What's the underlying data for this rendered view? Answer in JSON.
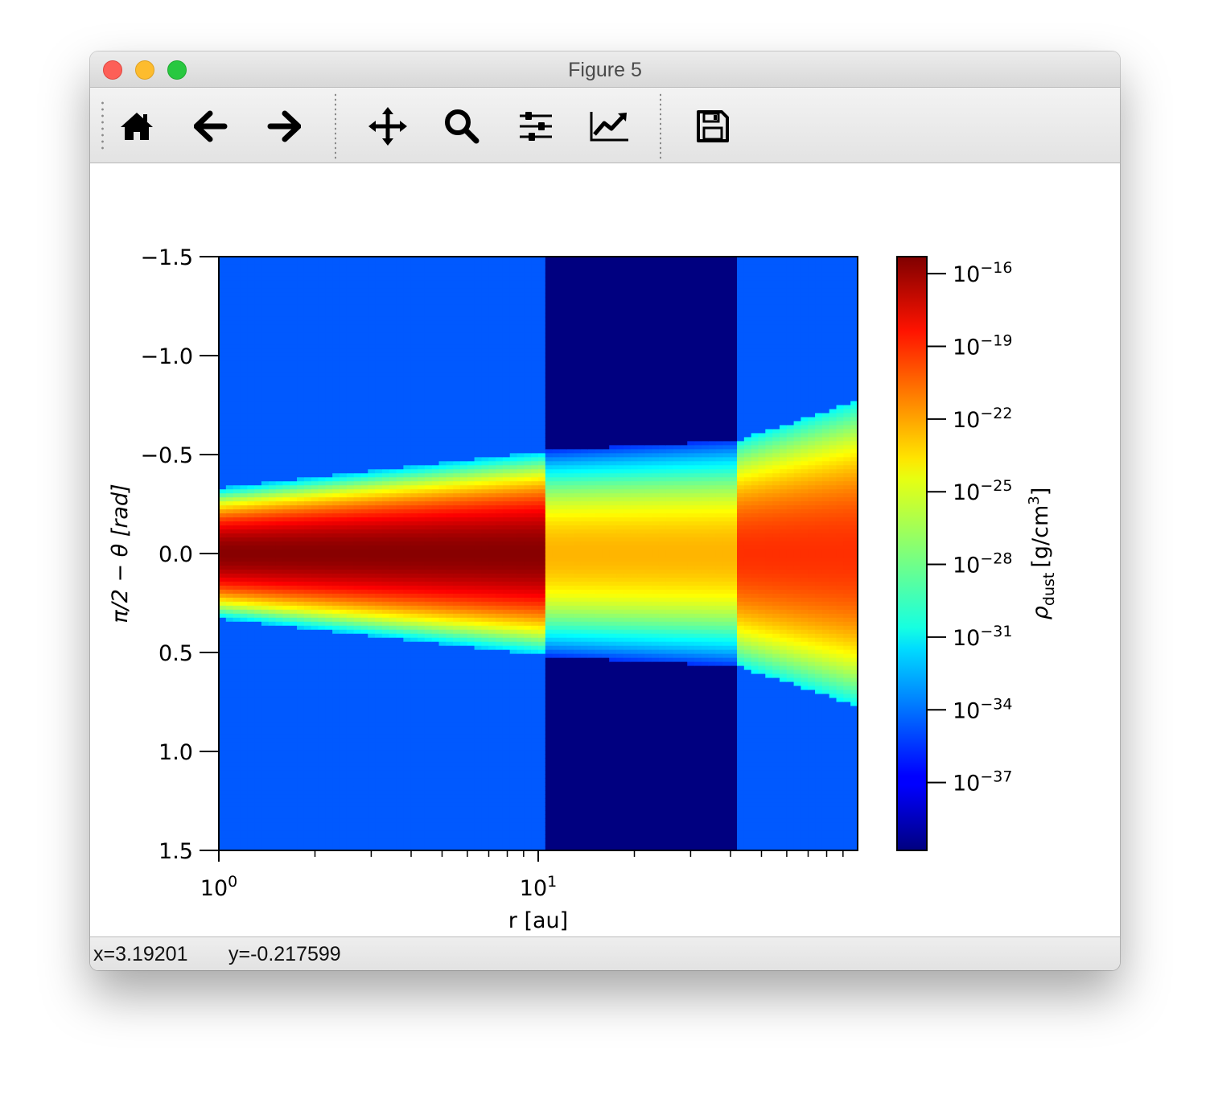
{
  "window": {
    "title": "Figure 5"
  },
  "toolbar": {
    "buttons": [
      {
        "name": "home-icon",
        "label": "Home"
      },
      {
        "name": "back-icon",
        "label": "Back"
      },
      {
        "name": "forward-icon",
        "label": "Forward"
      },
      {
        "name": "pan-icon",
        "label": "Pan"
      },
      {
        "name": "zoom-icon",
        "label": "Zoom"
      },
      {
        "name": "subplots-icon",
        "label": "Subplots"
      },
      {
        "name": "customize-icon",
        "label": "Customize"
      },
      {
        "name": "save-icon",
        "label": "Save"
      }
    ]
  },
  "status": {
    "x": "x=3.19201",
    "y": "y=-0.217599"
  },
  "chart_data": {
    "type": "heatmap",
    "colormap": "jet",
    "xlabel": "r [au]",
    "ylabel": "π/2 − θ [rad]",
    "xscale": "log",
    "x_range_au": [
      1,
      100
    ],
    "x_ticks": [
      {
        "value": 1,
        "base": "10",
        "exp": "0"
      },
      {
        "value": 10,
        "base": "10",
        "exp": "1"
      }
    ],
    "y_range": [
      -1.5,
      1.5
    ],
    "y_inverted": true,
    "y_ticks": [
      "−1.5",
      "−1.0",
      "−0.5",
      "0.0",
      "0.5",
      "1.0",
      "1.5"
    ],
    "y_tick_values": [
      -1.5,
      -1.0,
      -0.5,
      0.0,
      0.5,
      1.0,
      1.5
    ],
    "colorbar": {
      "label_symbol": "ρ",
      "label_sub": "dust",
      "label_units": "[g/cm",
      "label_sup": "3",
      "label_close": "]",
      "log_range": [
        -39.8,
        -15.3
      ],
      "ticks": [
        {
          "base": "10",
          "exp": "−16",
          "log": -16
        },
        {
          "base": "10",
          "exp": "−19",
          "log": -19
        },
        {
          "base": "10",
          "exp": "−22",
          "log": -22
        },
        {
          "base": "10",
          "exp": "−25",
          "log": -25
        },
        {
          "base": "10",
          "exp": "−28",
          "log": -28
        },
        {
          "base": "10",
          "exp": "−31",
          "log": -31
        },
        {
          "base": "10",
          "exp": "−34",
          "log": -34
        },
        {
          "base": "10",
          "exp": "−37",
          "log": -37
        }
      ]
    },
    "regions": [
      {
        "name": "inner disk",
        "r_range_au": [
          1,
          10.7
        ],
        "background_log_density": -34.6,
        "midplane_log_density": -15.5,
        "disk_half_width_rad": [
          0.33,
          0.52
        ],
        "edge_log_density": -32
      },
      {
        "name": "gap",
        "r_range_au": [
          10.7,
          42
        ],
        "background_log_density": -39.8,
        "midplane_log_density": -22.7,
        "disk_half_width_rad": [
          0.52,
          0.57
        ],
        "edge_log_density": -35.5
      },
      {
        "name": "outer disk",
        "r_range_au": [
          42,
          100
        ],
        "background_log_density": -34.6,
        "midplane_log_density": -19.5,
        "disk_half_width_rad": [
          0.57,
          0.77
        ],
        "edge_log_density": -30.6
      }
    ]
  }
}
